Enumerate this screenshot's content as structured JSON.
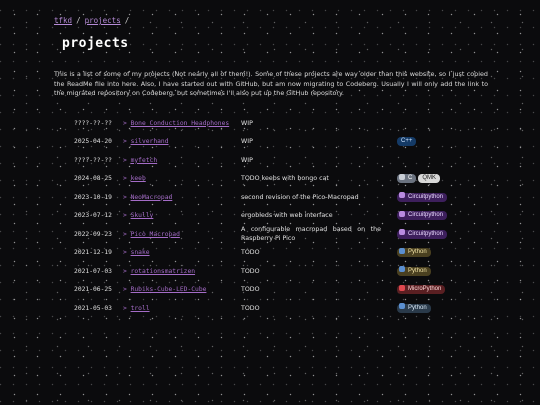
{
  "breadcrumb": {
    "home": "tfkd",
    "section": "projects",
    "separator": "/"
  },
  "title": "projects",
  "intro": "This is a list of some of my projects (Not nearly all of them!). Some of these projects are way older than this website, so I just copied the ReadMe file into here. Also, I have started out with GitHub, but am now migrating to Codeberg. Usually I will only add the link to the migrated repository on Codeberg, but sometimes I'll also put up the GitHub repository.",
  "projects": [
    {
      "date": "????-??-??",
      "name": "Bone Conduction Headphones",
      "desc": "WIP",
      "tags": []
    },
    {
      "date": "2025-04-20",
      "name": "silverhand",
      "desc": "WIP",
      "tags": [
        {
          "label": "C++",
          "bg": "#143a66",
          "fg": "#cfe4ff",
          "icon": "",
          "icon_color": ""
        }
      ]
    },
    {
      "date": "????-??-??",
      "name": "myfetch",
      "desc": "WIP",
      "tags": []
    },
    {
      "date": "2024-08-25",
      "name": "keeb",
      "desc": "TODO keebs with bongo cat",
      "tags": [
        {
          "label": "C",
          "bg": "#6b7380",
          "fg": "#ffffff",
          "icon": "c-logo-icon",
          "icon_color": "#c9ced6"
        },
        {
          "label": "QMK",
          "bg": "#d8d8d8",
          "fg": "#222222",
          "icon": "",
          "icon_color": ""
        }
      ]
    },
    {
      "date": "2023-10-19",
      "name": "NeoMacropad",
      "desc": "second revision of the Pico-Macropad",
      "tags": [
        {
          "label": "Circuitpython",
          "bg": "#3d1f5c",
          "fg": "#ead9ff",
          "icon": "circuitpython-snake-icon",
          "icon_color": "#b98be0"
        }
      ]
    },
    {
      "date": "2023-07-12",
      "name": "Skully",
      "desc": "ergobleds with web interface",
      "tags": [
        {
          "label": "Circuitpython",
          "bg": "#3d1f5c",
          "fg": "#ead9ff",
          "icon": "circuitpython-snake-icon",
          "icon_color": "#b98be0"
        }
      ]
    },
    {
      "date": "2022-09-23",
      "name": "Pico Macropad",
      "desc": "A configurable macropad based on the Raspberry Pi Pico",
      "tags": [
        {
          "label": "Circuitpython",
          "bg": "#3d1f5c",
          "fg": "#ead9ff",
          "icon": "circuitpython-snake-icon",
          "icon_color": "#b98be0"
        }
      ]
    },
    {
      "date": "2021-12-19",
      "name": "snake",
      "desc": "TODO",
      "tags": [
        {
          "label": "Python",
          "bg": "#4a4020",
          "fg": "#f3e3a6",
          "icon": "python-logo-icon",
          "icon_color": "#5b8fd0"
        }
      ]
    },
    {
      "date": "2021-07-03",
      "name": "rotationsmatrizen",
      "desc": "TODO",
      "tags": [
        {
          "label": "Python",
          "bg": "#4a4020",
          "fg": "#f3e3a6",
          "icon": "python-logo-icon",
          "icon_color": "#5b8fd0"
        }
      ]
    },
    {
      "date": "2021-06-25",
      "name": "Rubiks-Cube-LED-Cube",
      "desc": "TODO",
      "tags": [
        {
          "label": "MicroPython",
          "bg": "#5a1f22",
          "fg": "#ffdada",
          "icon": "micropython-logo-icon",
          "icon_color": "#e0484f"
        }
      ]
    },
    {
      "date": "2021-05-03",
      "name": "troll",
      "desc": "TODO",
      "tags": [
        {
          "label": "Python",
          "bg": "#2a3a4a",
          "fg": "#dbe9f7",
          "icon": "python-logo-icon",
          "icon_color": "#5b8fd0"
        }
      ]
    }
  ]
}
